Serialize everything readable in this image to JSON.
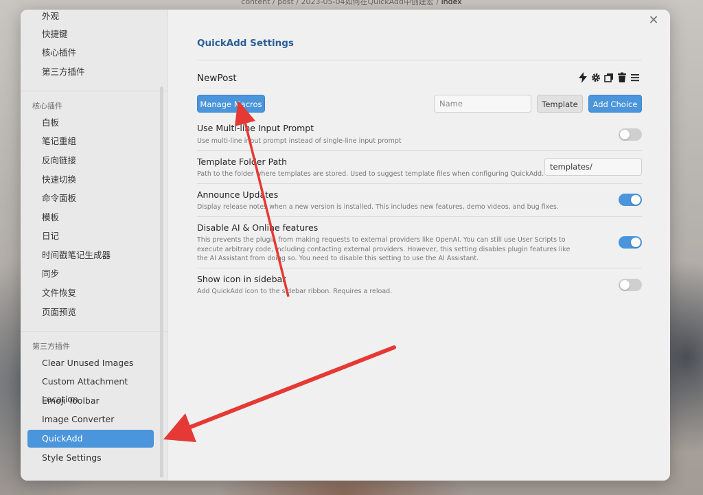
{
  "breadcrumb": {
    "path": "content / post / 2023-05-04如何在QuickAdd中创建宏",
    "current": "index"
  },
  "sidebar": {
    "top_items": [
      "外观",
      "快捷键",
      "核心插件",
      "第三方插件"
    ],
    "core_heading": "核心插件",
    "core_items": [
      "白板",
      "笔记重组",
      "反向链接",
      "快速切换",
      "命令面板",
      "模板",
      "日记",
      "时间戳笔记生成器",
      "同步",
      "文件恢复",
      "页面预览"
    ],
    "third_heading": "第三方插件",
    "third_items": [
      "Clear Unused Images",
      "Custom Attachment Location",
      "Emoji Toolbar",
      "Image Converter",
      "QuickAdd",
      "Style Settings"
    ],
    "active_item": "QuickAdd"
  },
  "main": {
    "title": "QuickAdd Settings",
    "choice": {
      "name": "NewPost",
      "icons": [
        "bolt-icon",
        "gear-icon",
        "duplicate-icon",
        "trash-icon",
        "menu-icon"
      ]
    },
    "toolbar": {
      "manage_macros": "Manage Macros",
      "name_placeholder": "Name",
      "template_button": "Template",
      "add_choice": "Add Choice"
    },
    "settings": [
      {
        "title": "Use Multi-line Input Prompt",
        "desc": "Use multi-line input prompt instead of single-line input prompt",
        "toggle": false
      },
      {
        "title": "Template Folder Path",
        "desc": "Path to the folder where templates are stored. Used to suggest template files when configuring QuickAdd.",
        "input_value": "templates/"
      },
      {
        "title": "Announce Updates",
        "desc": "Display release notes when a new version is installed. This includes new features, demo videos, and bug fixes.",
        "toggle": true
      },
      {
        "title": "Disable AI & Online features",
        "desc": "This prevents the plugin from making requests to external providers like OpenAI. You can still use User Scripts to execute arbitrary code, including contacting external providers. However, this setting disables plugin features like the AI Assistant from doing so. You need to disable this setting to use the AI Assistant.",
        "toggle": true
      },
      {
        "title": "Show icon in sidebar",
        "desc": "Add QuickAdd icon to the sidebar ribbon. Requires a reload.",
        "toggle": false
      }
    ]
  },
  "colors": {
    "accent": "#4a95db",
    "title": "#2a5f96",
    "annotation_arrow": "#e53935"
  }
}
